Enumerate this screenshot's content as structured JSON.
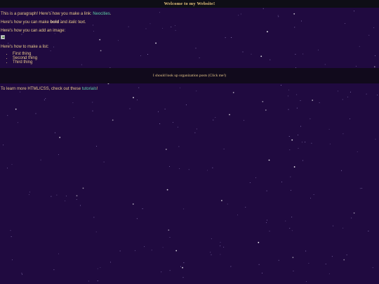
{
  "header": {
    "title": "Welcome to my Website!"
  },
  "intro": {
    "before_link": "This is a paragraph! Here's how you make a link: ",
    "link_label": "Neocities",
    "after_link": "."
  },
  "formatting": {
    "before_bold": "Here's how you can make ",
    "bold_text": "bold",
    "middle": " and ",
    "italic_text": "italic",
    "after": " text."
  },
  "image_section": {
    "text": "Here's how you can add an image:"
  },
  "list_section": {
    "heading": "Here's how to make a list:",
    "items": [
      "First thing",
      "Second thing",
      "Third thing"
    ]
  },
  "banner": {
    "text": "I should look up organization posts (Click me!)"
  },
  "footer": {
    "before_link": "To learn more HTML/CSS, check out these ",
    "link_label": "tutorials",
    "after_link": "!"
  },
  "colors": {
    "background": "#200a40",
    "header_bg": "#0e0e16",
    "text": "#e8c98a",
    "link": "#5fd0a6"
  }
}
